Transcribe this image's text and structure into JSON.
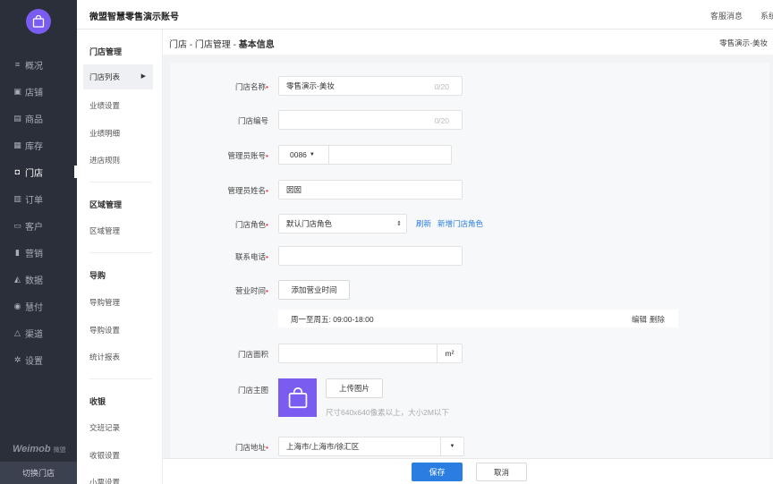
{
  "topbar": {
    "account_title": "微盟智慧零售演示账号",
    "service_msg": "客服消息",
    "system": "系统"
  },
  "nav": {
    "items": [
      {
        "label": "概况",
        "icon": "list-icon"
      },
      {
        "label": "店铺",
        "icon": "shop-icon"
      },
      {
        "label": "商品",
        "icon": "goods-icon"
      },
      {
        "label": "库存",
        "icon": "inventory-icon"
      },
      {
        "label": "门店",
        "icon": "store-icon"
      },
      {
        "label": "订单",
        "icon": "order-icon"
      },
      {
        "label": "客户",
        "icon": "customer-icon"
      },
      {
        "label": "营销",
        "icon": "marketing-icon"
      },
      {
        "label": "数据",
        "icon": "chart-icon"
      },
      {
        "label": "慧付",
        "icon": "pay-icon"
      },
      {
        "label": "渠道",
        "icon": "channel-icon"
      },
      {
        "label": "设置",
        "icon": "gear-icon"
      }
    ],
    "active_index": 4,
    "brand": "Weimob",
    "brand_sub": "微盟",
    "switch_store": "切换门店"
  },
  "submenu": {
    "groups": [
      {
        "title": "门店管理",
        "items": [
          "门店列表",
          "业绩设置",
          "业绩明细",
          "进店规则"
        ]
      },
      {
        "title": "区域管理",
        "items": [
          "区域管理"
        ]
      },
      {
        "title": "导购",
        "items": [
          "导购管理",
          "导购设置",
          "统计报表"
        ]
      },
      {
        "title": "收银",
        "items": [
          "交班记录",
          "收银设置",
          "小票设置"
        ]
      }
    ],
    "active_item": "门店列表"
  },
  "page": {
    "crumb_prefix": "门店 - 门店管理 - ",
    "crumb_current": "基本信息",
    "store_name": "零售演示-美妆"
  },
  "form": {
    "store_name": {
      "label": "门店名称",
      "value": "零售演示-美妆",
      "counter": "0/20"
    },
    "store_code": {
      "label": "门店编号",
      "value": "",
      "counter": "0/20"
    },
    "admin_account": {
      "label": "管理员账号",
      "country_code": "0086",
      "value": ""
    },
    "admin_name": {
      "label": "管理员姓名",
      "value": "囡囡"
    },
    "store_role": {
      "label": "门店角色",
      "value": "默认门店角色",
      "refresh": "刷新",
      "add_role": "新增门店角色"
    },
    "phone": {
      "label": "联系电话",
      "value": ""
    },
    "hours": {
      "label": "营业时间",
      "add_button": "添加营业时间",
      "entry": "周一至周五: 09:00-18:00",
      "edit": "编辑",
      "delete": "删除"
    },
    "area": {
      "label": "门店面积",
      "unit": "m²",
      "value": ""
    },
    "main_image": {
      "label": "门店主图",
      "upload_button": "上传图片",
      "hint": "尺寸640x640像素以上，大小2M以下"
    },
    "address": {
      "label": "门店地址",
      "value": "上海市/上海市/徐汇区"
    }
  },
  "actions": {
    "save": "保存",
    "cancel": "取消"
  },
  "colors": {
    "sidebar": "#2b2f3a",
    "primary": "#2a7de1",
    "logo": "#7a5cf0",
    "required": "#e33333"
  }
}
